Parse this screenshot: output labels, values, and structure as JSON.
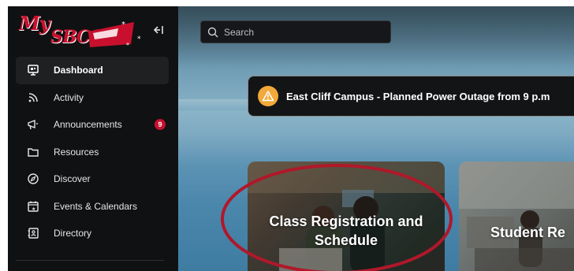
{
  "app": {
    "logo_line1": "My",
    "logo_line2": "SBCC"
  },
  "sidebar": {
    "items": [
      {
        "label": "Dashboard",
        "icon": "monitor-icon",
        "active": true
      },
      {
        "label": "Activity",
        "icon": "rss-icon"
      },
      {
        "label": "Announcements",
        "icon": "megaphone-icon",
        "badge": "9"
      },
      {
        "label": "Resources",
        "icon": "folder-icon"
      },
      {
        "label": "Discover",
        "icon": "compass-icon"
      },
      {
        "label": "Events & Calendars",
        "icon": "calendar-star-icon"
      },
      {
        "label": "Directory",
        "icon": "contacts-icon"
      }
    ]
  },
  "search": {
    "placeholder": "Search"
  },
  "alert": {
    "text": "East Cliff Campus - Planned Power Outage from 9 p.m"
  },
  "cards": [
    {
      "title_line1": "Class Registration and",
      "title_line2": "Schedule"
    },
    {
      "title_line1": "Student Re"
    }
  ],
  "colors": {
    "brand": "#c8102e",
    "sidebar_bg": "#101112",
    "alert_icon": "#f2a93b",
    "highlight_ellipse": "#b0182a"
  }
}
